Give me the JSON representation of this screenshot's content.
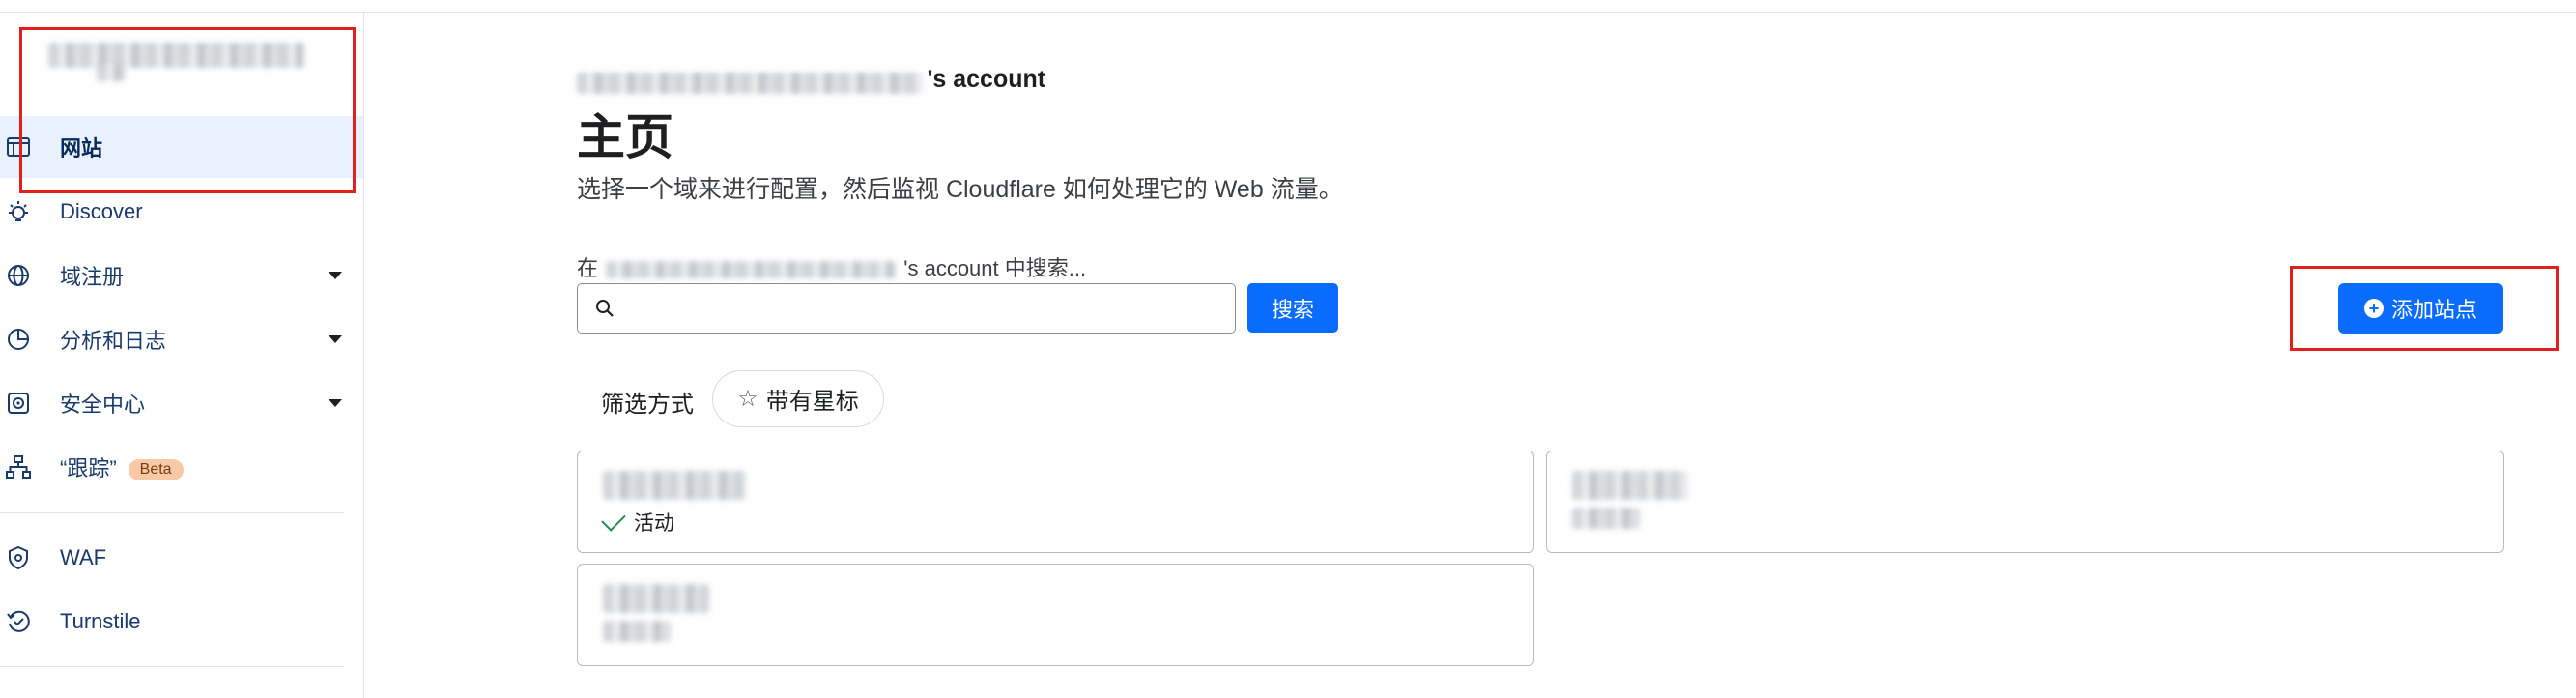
{
  "sidebar": {
    "items": [
      {
        "label": "网站",
        "icon": "browser-window-icon"
      },
      {
        "label": "Discover",
        "icon": "lightbulb-icon"
      },
      {
        "label": "域注册",
        "icon": "globe-icon"
      },
      {
        "label": "分析和日志",
        "icon": "pie-chart-icon"
      },
      {
        "label": "安全中心",
        "icon": "security-center-icon"
      },
      {
        "label": "“跟踪”",
        "icon": "sitemap-icon",
        "badge": "Beta"
      },
      {
        "label": "WAF",
        "icon": "shield-gear-icon"
      },
      {
        "label": "Turnstile",
        "icon": "turnstile-icon"
      }
    ]
  },
  "main": {
    "account_header_suffix": "'s account",
    "title": "主页",
    "description": "选择一个域来进行配置，然后监视 Cloudflare 如何处理它的 Web 流量。",
    "search_label_prefix": "在",
    "search_label_suffix": "'s account 中搜索...",
    "search_value": "",
    "search_button": "搜索",
    "filter_label": "筛选方式",
    "starred_chip": "带有星标",
    "add_site_button": "添加站点",
    "sites": [
      {
        "status": "活动"
      },
      {
        "status": ""
      },
      {
        "status": ""
      }
    ]
  },
  "colors": {
    "accent": "#0a6cff",
    "highlight_box": "#e0201c",
    "active_nav_bg": "#e8f1fd",
    "beta_badge": "#f8c9a6",
    "status_active": "#1f8f4e"
  }
}
